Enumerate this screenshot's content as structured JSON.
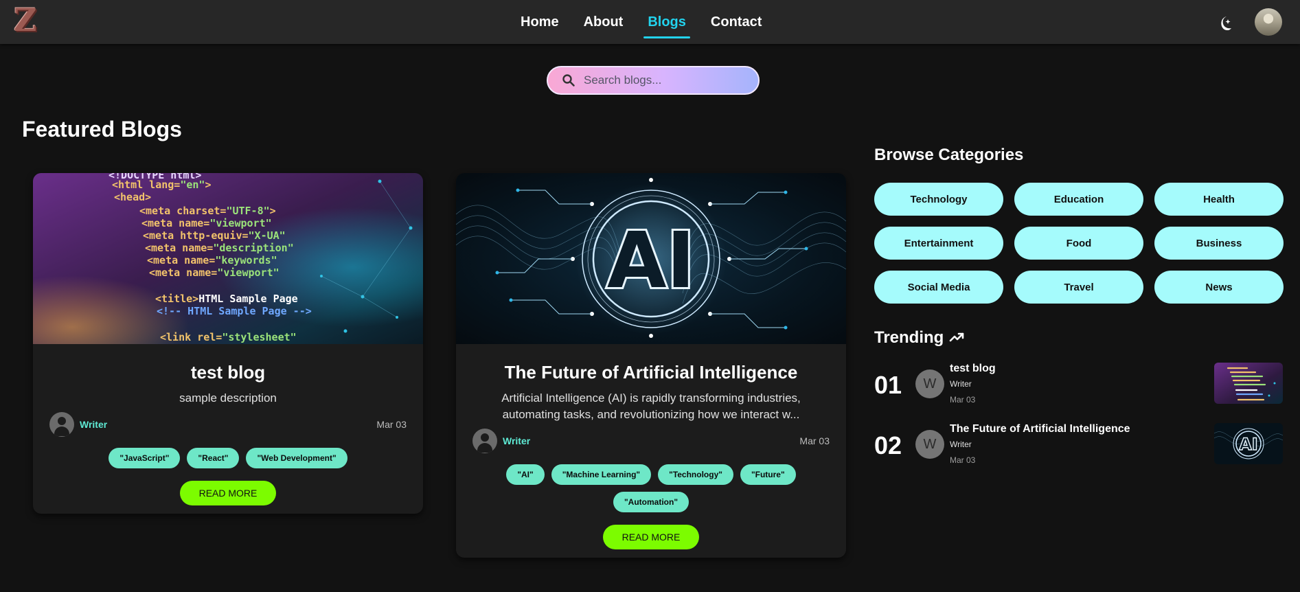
{
  "nav": {
    "logo": "Z",
    "links": [
      "Home",
      "About",
      "Blogs",
      "Contact"
    ],
    "active": "Blogs"
  },
  "search": {
    "placeholder": "Search blogs..."
  },
  "featured": {
    "title": "Featured Blogs",
    "blogs": [
      {
        "title": "test blog",
        "description": "sample description",
        "author": "Writer",
        "date": "Mar 03",
        "tags": [
          "\"JavaScript\"",
          "\"React\"",
          "\"Web Development\""
        ],
        "read_more": "READ MORE"
      },
      {
        "title": "The Future of Artificial Intelligence",
        "description": "Artificial Intelligence (AI) is rapidly transforming industries, automating tasks, and revolutionizing how we interact w...",
        "author": "Writer",
        "date": "Mar 03",
        "tags": [
          "\"AI\"",
          "\"Machine Learning\"",
          "\"Technology\"",
          "\"Future\"",
          "\"Automation\""
        ],
        "read_more": "READ MORE",
        "image_text": "AI"
      }
    ]
  },
  "categories": {
    "title": "Browse Categories",
    "items": [
      "Technology",
      "Education",
      "Health",
      "Entertainment",
      "Food",
      "Business",
      "Social Media",
      "Travel",
      "News"
    ]
  },
  "trending": {
    "title": "Trending",
    "items": [
      {
        "rank": "01",
        "avatar": "W",
        "title": "test blog",
        "author": "Writer",
        "date": "Mar 03"
      },
      {
        "rank": "02",
        "avatar": "W",
        "title": "The Future of Artificial Intelligence",
        "author": "Writer",
        "date": "Mar 03"
      }
    ]
  },
  "colors": {
    "background": "#121212",
    "navbar": "#272727",
    "accent": "#22d3ee",
    "tag": "#6ee7c7",
    "category": "#a5fbfc",
    "read_more": "#7cfc00"
  }
}
